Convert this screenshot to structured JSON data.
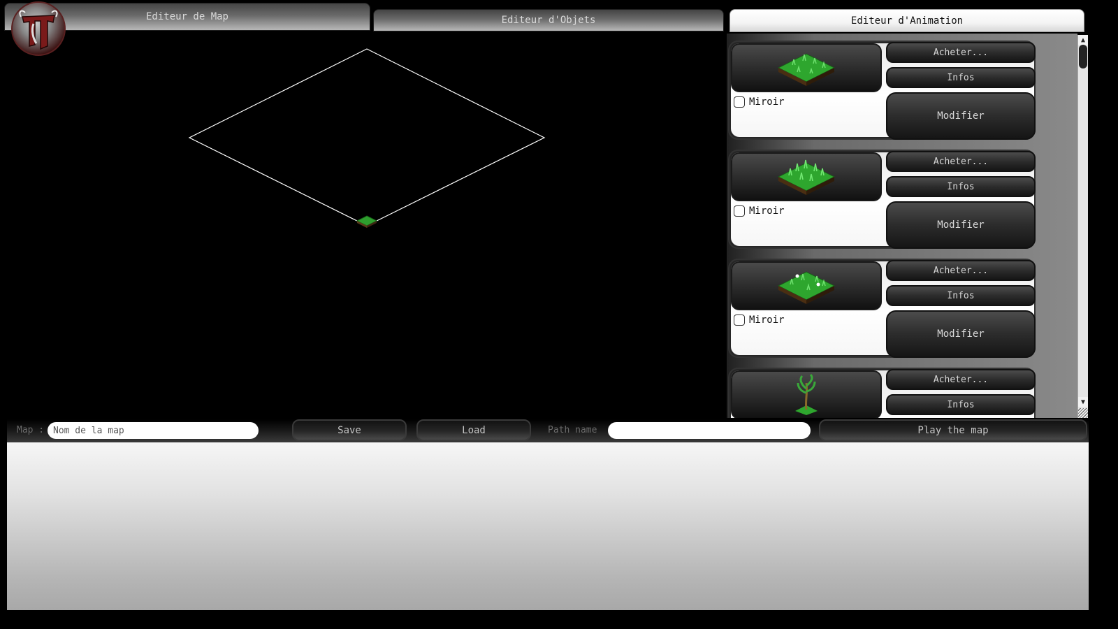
{
  "tabs": {
    "map_editor": "Editeur de Map",
    "object_editor": "Editeur d'Objets",
    "animation_editor": "Editeur d'Animation",
    "active": "animation_editor"
  },
  "logo": {
    "icon": "stag-crest-logo"
  },
  "objects": [
    {
      "thumbnail": "grass-tile",
      "miroir_label": "Miroir",
      "miroir_checked": false,
      "buy_label": "Acheter...",
      "info_label": "Infos",
      "modify_label": "Modifier"
    },
    {
      "thumbnail": "grass-tile-tall",
      "miroir_label": "Miroir",
      "miroir_checked": false,
      "buy_label": "Acheter...",
      "info_label": "Infos",
      "modify_label": "Modifier"
    },
    {
      "thumbnail": "grass-tile-flowers",
      "miroir_label": "Miroir",
      "miroir_checked": false,
      "buy_label": "Acheter...",
      "info_label": "Infos",
      "modify_label": "Modifier"
    },
    {
      "thumbnail": "tree-on-grass",
      "buy_label": "Acheter...",
      "info_label": "Infos"
    }
  ],
  "toolbar": {
    "map_label": "Map :",
    "map_placeholder": "Nom de la map",
    "map_value": "",
    "save_label": "Save",
    "load_label": "Load",
    "path_label": "Path name",
    "path_value": "",
    "play_label": "Play the map"
  },
  "colors": {
    "grass": "#2e9e2e",
    "grass_dark": "#1a6a1a",
    "soil": "#5a3a1a",
    "grid_line": "#ffffff"
  }
}
